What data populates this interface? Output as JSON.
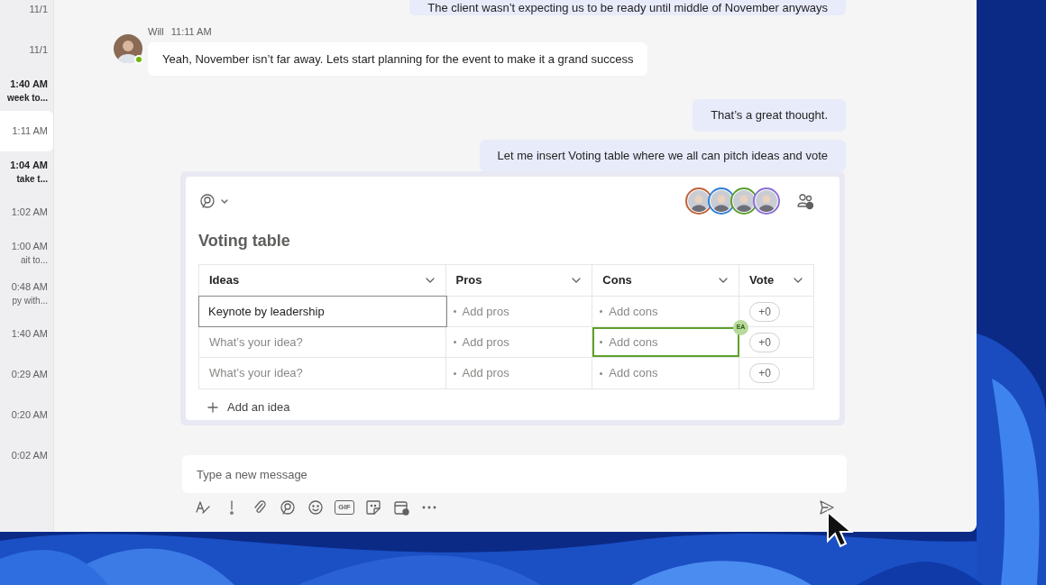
{
  "sidebar": {
    "items": [
      {
        "time": "11/1",
        "bold": false,
        "selected": false
      },
      {
        "time": "11/1",
        "bold": false,
        "selected": false
      },
      {
        "time": "1:40 AM",
        "preview": "week to...",
        "bold": true,
        "selected": false
      },
      {
        "time": "1:11 AM",
        "bold": false,
        "selected": true
      },
      {
        "time": "1:04 AM",
        "preview": "take t...",
        "bold": true,
        "selected": false
      },
      {
        "time": "1:02 AM",
        "bold": false,
        "selected": false
      },
      {
        "time": "1:00 AM",
        "preview": "ait to...",
        "bold": false,
        "selected": false
      },
      {
        "time": "0:48 AM",
        "preview": "py with...",
        "bold": false,
        "selected": false
      },
      {
        "time": "1:40 AM",
        "bold": false,
        "selected": false
      },
      {
        "time": "0:29 AM",
        "bold": false,
        "selected": false
      },
      {
        "time": "0:20 AM",
        "bold": false,
        "selected": false
      },
      {
        "time": "0:02 AM",
        "bold": false,
        "selected": false
      }
    ]
  },
  "messages": [
    {
      "kind": "sent",
      "text": "The client wasn’t expecting us to be ready until middle of November anyways"
    },
    {
      "kind": "received",
      "author": "Will",
      "time": "11:11 AM",
      "online": true,
      "text": "Yeah, November isn’t far away. Lets start planning for the event to make it a grand success"
    },
    {
      "kind": "sent",
      "text": "That’s a great thought."
    },
    {
      "kind": "sent",
      "text": "Let me insert Voting table where we all can pitch ideas and vote"
    }
  ],
  "voting_card": {
    "title": "Voting table",
    "participants": [
      {
        "color": "#c0633d"
      },
      {
        "color": "#2f80d8"
      },
      {
        "color": "#5a9e2f"
      },
      {
        "color": "#8b6fd6"
      }
    ],
    "columns": [
      {
        "label": "Ideas"
      },
      {
        "label": "Pros"
      },
      {
        "label": "Cons"
      },
      {
        "label": "Vote"
      }
    ],
    "rows": [
      {
        "idea": {
          "value": "Keynote by leadership",
          "focused": true
        },
        "pros": {
          "placeholder": "Add pros"
        },
        "cons": {
          "placeholder": "Add cons"
        },
        "vote": "+0"
      },
      {
        "idea": {
          "placeholder": "What’s your idea?",
          "focused": false
        },
        "pros": {
          "placeholder": "Add pros"
        },
        "cons": {
          "placeholder": "Add cons",
          "editor": {
            "initials": "EA",
            "color": "#5ea02c"
          }
        },
        "vote": "+0"
      },
      {
        "idea": {
          "placeholder": "What’s your idea?",
          "focused": false
        },
        "pros": {
          "placeholder": "Add pros"
        },
        "cons": {
          "placeholder": "Add cons"
        },
        "vote": "+0"
      }
    ],
    "add_label": "Add an idea"
  },
  "composer": {
    "placeholder": "Type a new message",
    "gif_label": "GIF"
  }
}
